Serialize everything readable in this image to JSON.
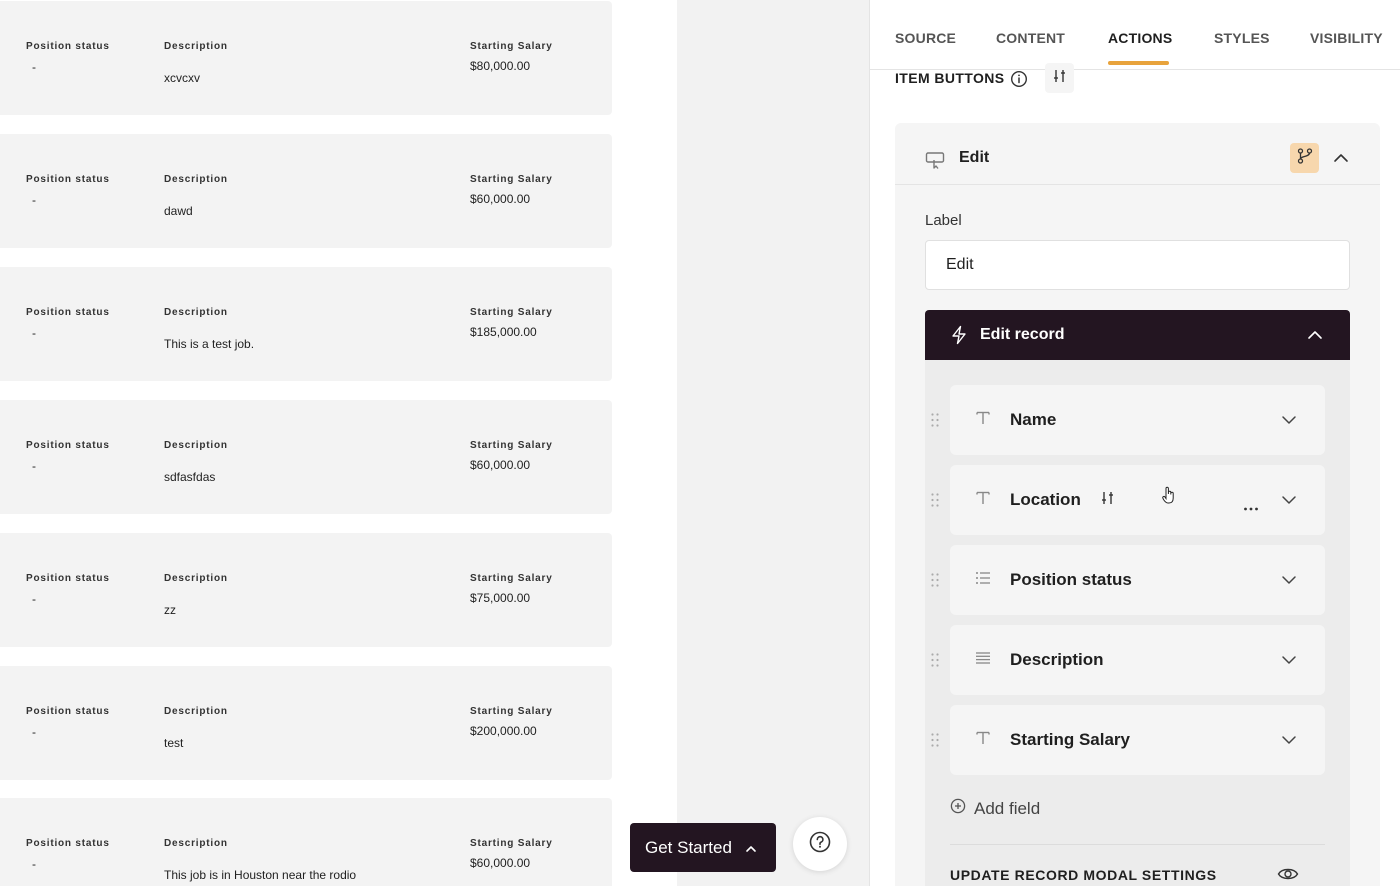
{
  "records": [
    {
      "status_label": "Position status",
      "status": "-",
      "desc_label": "Description",
      "description": "xcvcxv",
      "salary_label": "Starting Salary",
      "salary": "$80,000.00"
    },
    {
      "status_label": "Position status",
      "status": "-",
      "desc_label": "Description",
      "description": "dawd",
      "salary_label": "Starting Salary",
      "salary": "$60,000.00"
    },
    {
      "status_label": "Position status",
      "status": "-",
      "desc_label": "Description",
      "description": "This is a test job.",
      "salary_label": "Starting Salary",
      "salary": "$185,000.00"
    },
    {
      "status_label": "Position status",
      "status": "-",
      "desc_label": "Description",
      "description": "sdfasfdas",
      "salary_label": "Starting Salary",
      "salary": "$60,000.00"
    },
    {
      "status_label": "Position status",
      "status": "-",
      "desc_label": "Description",
      "description": "zz",
      "salary_label": "Starting Salary",
      "salary": "$75,000.00"
    },
    {
      "status_label": "Position status",
      "status": "-",
      "desc_label": "Description",
      "description": "test",
      "salary_label": "Starting Salary",
      "salary": "$200,000.00"
    },
    {
      "status_label": "Position status",
      "status": "-",
      "desc_label": "Description",
      "description": "This job is in Houston near the rodio",
      "salary_label": "Starting Salary",
      "salary": "$60,000.00"
    }
  ],
  "floating": {
    "get_started": "Get Started",
    "help_icon": "question-circle-icon"
  },
  "panel": {
    "tabs": [
      {
        "label": "SOURCE"
      },
      {
        "label": "CONTENT"
      },
      {
        "label": "ACTIONS",
        "active": true
      },
      {
        "label": "STYLES"
      },
      {
        "label": "VISIBILITY"
      }
    ],
    "item_buttons_title": "ITEM BUTTONS",
    "button": {
      "title": "Edit",
      "label_title": "Label",
      "label_value": "Edit",
      "action": {
        "title": "Edit record",
        "fields": [
          {
            "name": "Name",
            "type": "text"
          },
          {
            "name": "Location",
            "type": "text"
          },
          {
            "name": "Position status",
            "type": "list"
          },
          {
            "name": "Description",
            "type": "paragraph"
          },
          {
            "name": "Starting Salary",
            "type": "text"
          }
        ],
        "add_field": "Add field",
        "modal_settings_title": "UPDATE RECORD MODAL SETTINGS"
      }
    }
  },
  "colors": {
    "accent": "#e8a33c",
    "dark": "#231521",
    "branch_bg": "#f7d7ad"
  }
}
